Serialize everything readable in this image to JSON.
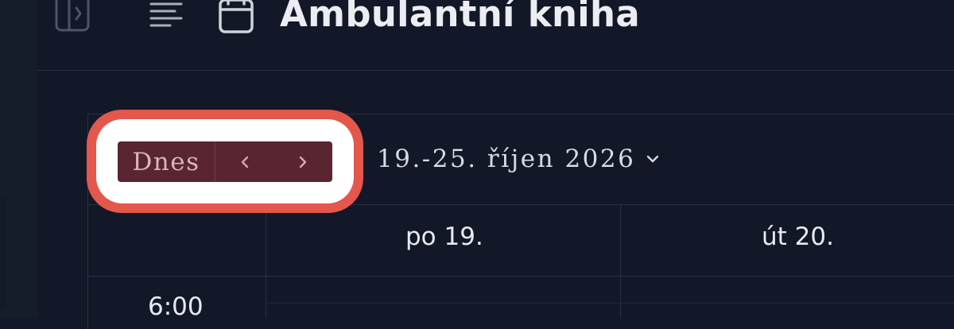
{
  "header": {
    "title": "Ambulantní kniha",
    "icons": {
      "sidebar_toggle": "sidebar-toggle-icon",
      "menu": "menu-lines-icon",
      "calendar": "calendar-icon"
    }
  },
  "toolbar": {
    "today_label": "Dnes",
    "prev_icon": "chevron-left-icon",
    "next_icon": "chevron-right-icon",
    "date_range_label": "19.-25. říjen 2026",
    "date_range_icon": "chevron-down-icon"
  },
  "grid": {
    "days": [
      "po 19.",
      "út 20."
    ],
    "times": [
      "6:00"
    ]
  },
  "colors": {
    "background": "#121827",
    "highlight_ring": "#e4574c",
    "nav_group": "#5a2430",
    "grid_line": "#263244"
  }
}
